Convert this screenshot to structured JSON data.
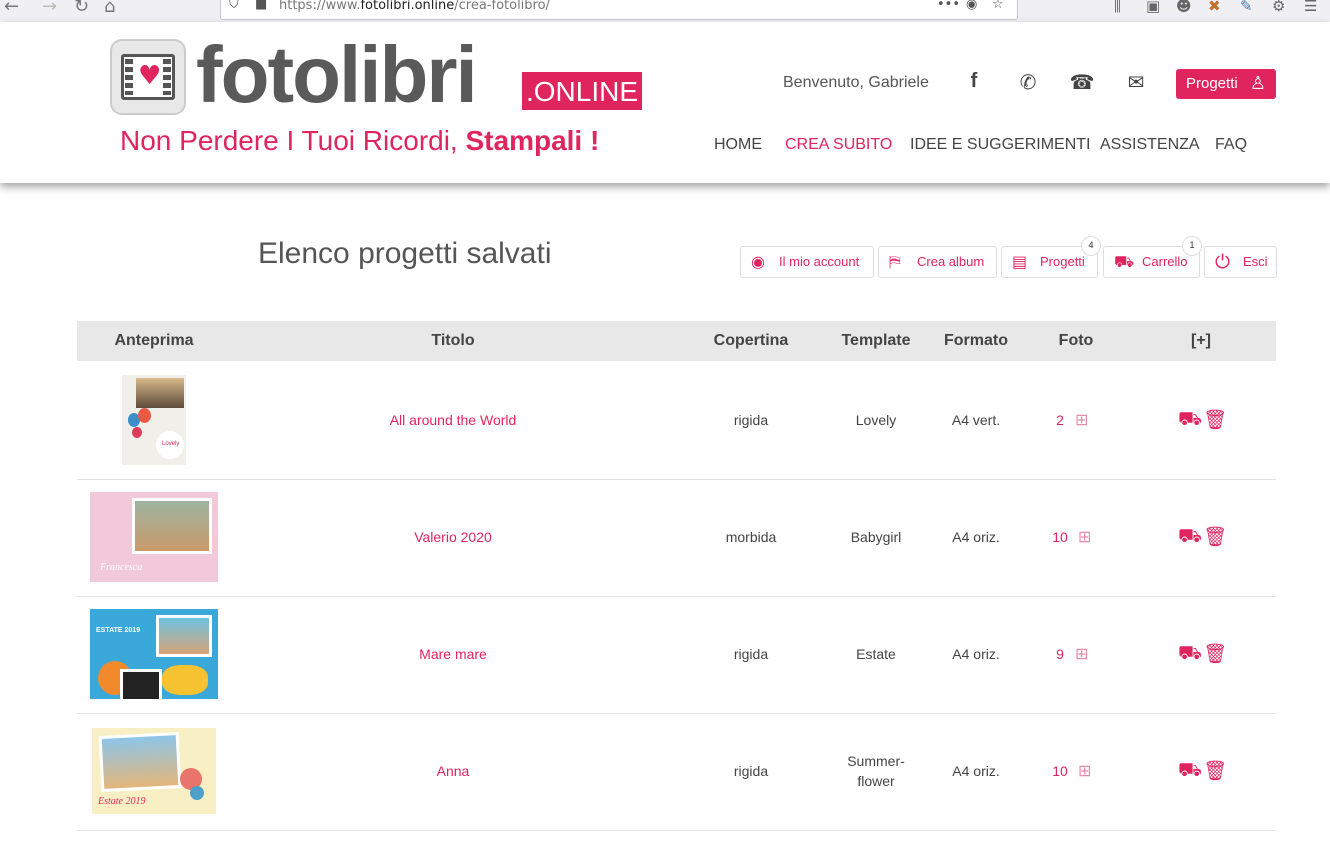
{
  "browser": {
    "url_prefix": "https://www.",
    "url_domain": "fotolibri.online",
    "url_path": "/crea-fotolibro/"
  },
  "header": {
    "logo_text": "fotolibri",
    "logo_badge": ".ONLINE",
    "tagline_prefix": "Non  Perdere I Tuoi Ricordi, ",
    "tagline_bold": "Stampali !",
    "welcome": "Benvenuto, Gabriele",
    "projects_button": "Progetti",
    "nav": [
      "HOME",
      "CREA SUBITO",
      "IDEE E SUGGERIMENTI",
      "ASSISTENZA",
      "FAQ"
    ],
    "active_nav": "CREA SUBITO"
  },
  "page": {
    "title": "Elenco progetti salvati",
    "toolbar": {
      "account": "Il mio account",
      "crea_album": "Crea album",
      "progetti": "Progetti",
      "progetti_count": "4",
      "carrello": "Carrello",
      "carrello_count": "1",
      "esci": "Esci"
    }
  },
  "table": {
    "headers": [
      "Anteprima",
      "Titolo",
      "Copertina",
      "Template",
      "Formato",
      "Foto",
      "[+]"
    ],
    "rows": [
      {
        "title": "All around the World",
        "copertina": "rigida",
        "template": "Lovely",
        "template_line2": "",
        "formato": "A4 vert.",
        "foto": "2"
      },
      {
        "title": "Valerio 2020",
        "copertina": "morbida",
        "template": "Babygirl",
        "template_line2": "",
        "formato": "A4 oriz.",
        "foto": "10"
      },
      {
        "title": "Mare mare",
        "copertina": "rigida",
        "template": "Estate",
        "template_line2": "",
        "formato": "A4 oriz.",
        "foto": "9"
      },
      {
        "title": "Anna",
        "copertina": "rigida",
        "template": "Summer-",
        "template_line2": "flower",
        "formato": "A4 oriz.",
        "foto": "10"
      }
    ],
    "thumb_texts": {
      "lovely": "Lovely",
      "babygirl": "Francesca",
      "estate": "ESTATE 2019",
      "summer": "Estate 2019"
    }
  },
  "colors": {
    "accent": "#e0245e",
    "header_bg": "#e8e8e8"
  }
}
